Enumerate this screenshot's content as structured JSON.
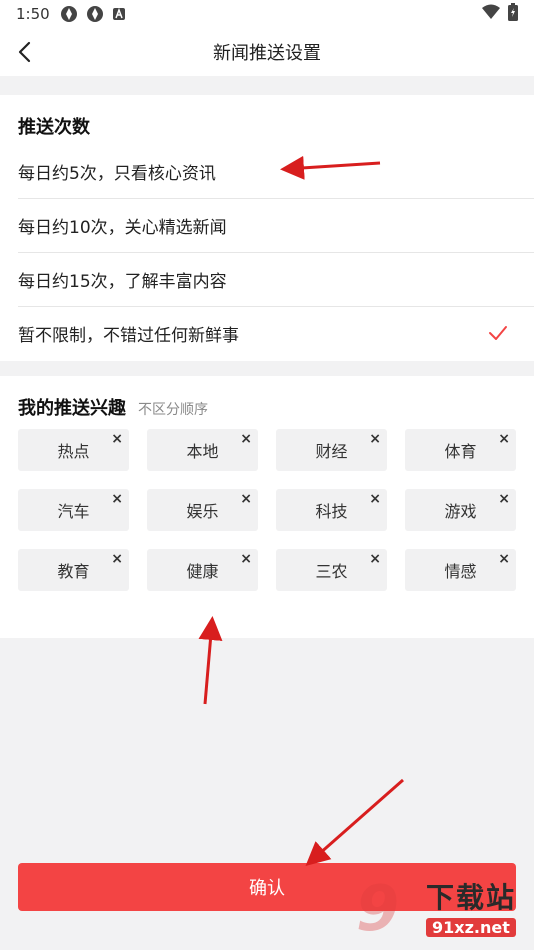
{
  "status_bar": {
    "time": "1:50"
  },
  "nav": {
    "title": "新闻推送设置"
  },
  "frequency": {
    "title": "推送次数",
    "options": [
      {
        "label": "每日约5次，只看核心资讯",
        "selected": false
      },
      {
        "label": "每日约10次，关心精选新闻",
        "selected": false
      },
      {
        "label": "每日约15次，了解丰富内容",
        "selected": false
      },
      {
        "label": "暂不限制，不错过任何新鲜事",
        "selected": true
      }
    ]
  },
  "interests": {
    "title": "我的推送兴趣",
    "subtitle": "不区分顺序",
    "tags": [
      "热点",
      "本地",
      "财经",
      "体育",
      "汽车",
      "娱乐",
      "科技",
      "游戏",
      "教育",
      "健康",
      "三农",
      "情感"
    ],
    "remove_symbol": "×"
  },
  "confirm_label": "确认",
  "watermark": {
    "brand_number": "9",
    "brand_text": "下载站",
    "url": "91xz.net"
  },
  "colors": {
    "accent": "#f34444",
    "arrow": "#d81e1e",
    "background": "#f2f2f3"
  }
}
